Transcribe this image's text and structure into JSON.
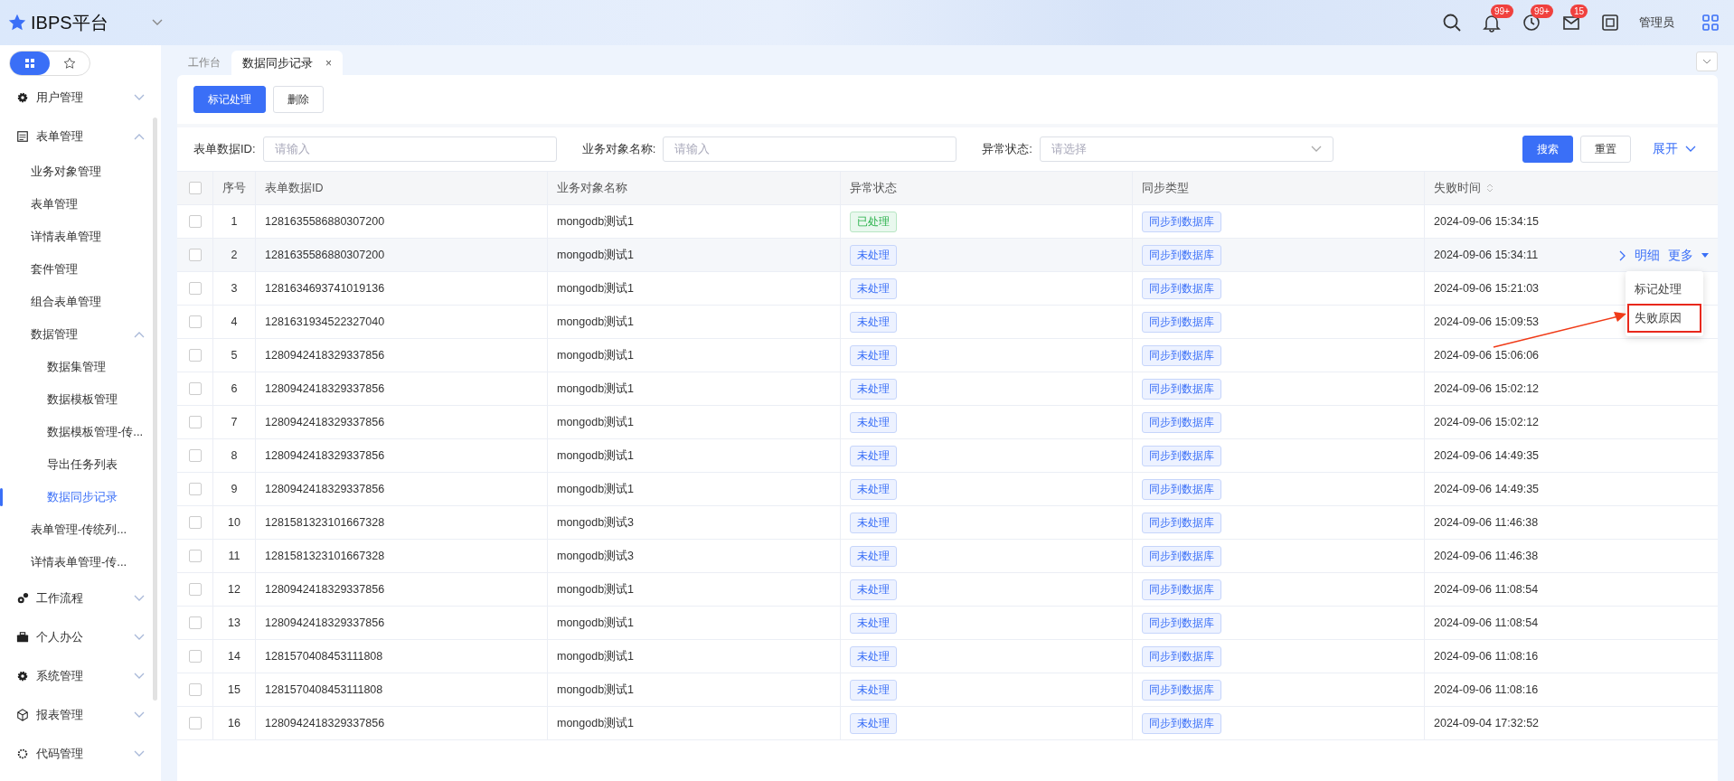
{
  "header": {
    "logo_text": "IBPS平台",
    "user": "管理员",
    "badges": [
      {
        "kind": "bell",
        "count": "99+"
      },
      {
        "kind": "clock",
        "count": "99+"
      },
      {
        "kind": "mail",
        "count": "15"
      }
    ]
  },
  "sidebar": {
    "modes": [
      {
        "kind": "grid",
        "selected": true
      },
      {
        "kind": "star",
        "selected": false
      }
    ],
    "items": [
      {
        "label": "用户管理",
        "kind": "gear",
        "expanded": false
      },
      {
        "label": "表单管理",
        "kind": "form",
        "expanded": true,
        "children": [
          {
            "label": "业务对象管理",
            "selected": false
          },
          {
            "label": "表单管理",
            "selected": false
          },
          {
            "label": "详情表单管理",
            "selected": false
          },
          {
            "label": "套件管理",
            "selected": false
          },
          {
            "label": "组合表单管理",
            "selected": false
          },
          {
            "label": "数据管理",
            "selected": false,
            "expanded": true,
            "children": [
              {
                "label": "数据集管理",
                "selected": false
              },
              {
                "label": "数据模板管理",
                "selected": false
              },
              {
                "label": "数据模板管理-传...",
                "selected": false
              },
              {
                "label": "导出任务列表",
                "selected": false
              },
              {
                "label": "数据同步记录",
                "selected": true
              }
            ]
          },
          {
            "label": "表单管理-传统列...",
            "selected": false
          },
          {
            "label": "详情表单管理-传...",
            "selected": false
          }
        ]
      },
      {
        "label": "工作流程",
        "kind": "gears",
        "expanded": false
      },
      {
        "label": "个人办公",
        "kind": "briefcase",
        "expanded": false
      },
      {
        "label": "系统管理",
        "kind": "gear",
        "expanded": false
      },
      {
        "label": "报表管理",
        "kind": "cube",
        "expanded": false
      },
      {
        "label": "代码管理",
        "kind": "cog",
        "expanded": false
      }
    ]
  },
  "tabs": [
    {
      "label": "工作台",
      "selected": false
    },
    {
      "label": "数据同步记录",
      "selected": true,
      "close": "×"
    }
  ],
  "toolbar": {
    "buttons": [
      {
        "label": "标记处理",
        "kind": "primary"
      },
      {
        "label": "删除",
        "kind": "default"
      }
    ]
  },
  "filters": {
    "fields": [
      {
        "label": "表单数据ID:",
        "placeholder": "请输入",
        "kind": "input"
      },
      {
        "label": "业务对象名称:",
        "placeholder": "请输入",
        "kind": "input"
      },
      {
        "label": "异常状态:",
        "placeholder": "请选择",
        "kind": "select"
      }
    ],
    "search": "搜索",
    "reset": "重置",
    "expand": "展开"
  },
  "table": {
    "select_all_checked": false,
    "columns": [
      "序号",
      "表单数据ID",
      "业务对象名称",
      "异常状态",
      "同步类型",
      "失败时间"
    ],
    "rows": [
      {
        "checked": false,
        "no": "1",
        "id": "1281635586880307200",
        "name": "mongodb测试1",
        "status": "已处理",
        "kind": "done",
        "type": "同步到数据库",
        "time": "2024-09-06 15:34:15",
        "hovered": false
      },
      {
        "checked": false,
        "no": "2",
        "id": "1281635586880307200",
        "name": "mongodb测试1",
        "status": "未处理",
        "kind": "pending",
        "type": "同步到数据库",
        "time": "2024-09-06 15:34:11",
        "hovered": true
      },
      {
        "checked": false,
        "no": "3",
        "id": "1281634693741019136",
        "name": "mongodb测试1",
        "status": "未处理",
        "kind": "pending",
        "type": "同步到数据库",
        "time": "2024-09-06 15:21:03",
        "hovered": false
      },
      {
        "checked": false,
        "no": "4",
        "id": "1281631934522327040",
        "name": "mongodb测试1",
        "status": "未处理",
        "kind": "pending",
        "type": "同步到数据库",
        "time": "2024-09-06 15:09:53",
        "hovered": false
      },
      {
        "checked": false,
        "no": "5",
        "id": "1280942418329337856",
        "name": "mongodb测试1",
        "status": "未处理",
        "kind": "pending",
        "type": "同步到数据库",
        "time": "2024-09-06 15:06:06",
        "hovered": false
      },
      {
        "checked": false,
        "no": "6",
        "id": "1280942418329337856",
        "name": "mongodb测试1",
        "status": "未处理",
        "kind": "pending",
        "type": "同步到数据库",
        "time": "2024-09-06 15:02:12",
        "hovered": false
      },
      {
        "checked": false,
        "no": "7",
        "id": "1280942418329337856",
        "name": "mongodb测试1",
        "status": "未处理",
        "kind": "pending",
        "type": "同步到数据库",
        "time": "2024-09-06 15:02:12",
        "hovered": false
      },
      {
        "checked": false,
        "no": "8",
        "id": "1280942418329337856",
        "name": "mongodb测试1",
        "status": "未处理",
        "kind": "pending",
        "type": "同步到数据库",
        "time": "2024-09-06 14:49:35",
        "hovered": false
      },
      {
        "checked": false,
        "no": "9",
        "id": "1280942418329337856",
        "name": "mongodb测试1",
        "status": "未处理",
        "kind": "pending",
        "type": "同步到数据库",
        "time": "2024-09-06 14:49:35",
        "hovered": false
      },
      {
        "checked": false,
        "no": "10",
        "id": "1281581323101667328",
        "name": "mongodb测试3",
        "status": "未处理",
        "kind": "pending",
        "type": "同步到数据库",
        "time": "2024-09-06 11:46:38",
        "hovered": false
      },
      {
        "checked": false,
        "no": "11",
        "id": "1281581323101667328",
        "name": "mongodb测试3",
        "status": "未处理",
        "kind": "pending",
        "type": "同步到数据库",
        "time": "2024-09-06 11:46:38",
        "hovered": false
      },
      {
        "checked": false,
        "no": "12",
        "id": "1280942418329337856",
        "name": "mongodb测试1",
        "status": "未处理",
        "kind": "pending",
        "type": "同步到数据库",
        "time": "2024-09-06 11:08:54",
        "hovered": false
      },
      {
        "checked": false,
        "no": "13",
        "id": "1280942418329337856",
        "name": "mongodb测试1",
        "status": "未处理",
        "kind": "pending",
        "type": "同步到数据库",
        "time": "2024-09-06 11:08:54",
        "hovered": false
      },
      {
        "checked": false,
        "no": "14",
        "id": "1281570408453111808",
        "name": "mongodb测试1",
        "status": "未处理",
        "kind": "pending",
        "type": "同步到数据库",
        "time": "2024-09-06 11:08:16",
        "hovered": false
      },
      {
        "checked": false,
        "no": "15",
        "id": "1281570408453111808",
        "name": "mongodb测试1",
        "status": "未处理",
        "kind": "pending",
        "type": "同步到数据库",
        "time": "2024-09-06 11:08:16",
        "hovered": false
      },
      {
        "checked": false,
        "no": "16",
        "id": "1280942418329337856",
        "name": "mongodb测试1",
        "status": "未处理",
        "kind": "pending",
        "type": "同步到数据库",
        "time": "2024-09-04 17:32:52",
        "hovered": false
      }
    ],
    "row_actions": {
      "detail": "明细",
      "more": "更多"
    },
    "more_menu": [
      {
        "label": "标记处理",
        "highlighted": false
      },
      {
        "label": "失败原因",
        "highlighted": true
      }
    ]
  }
}
